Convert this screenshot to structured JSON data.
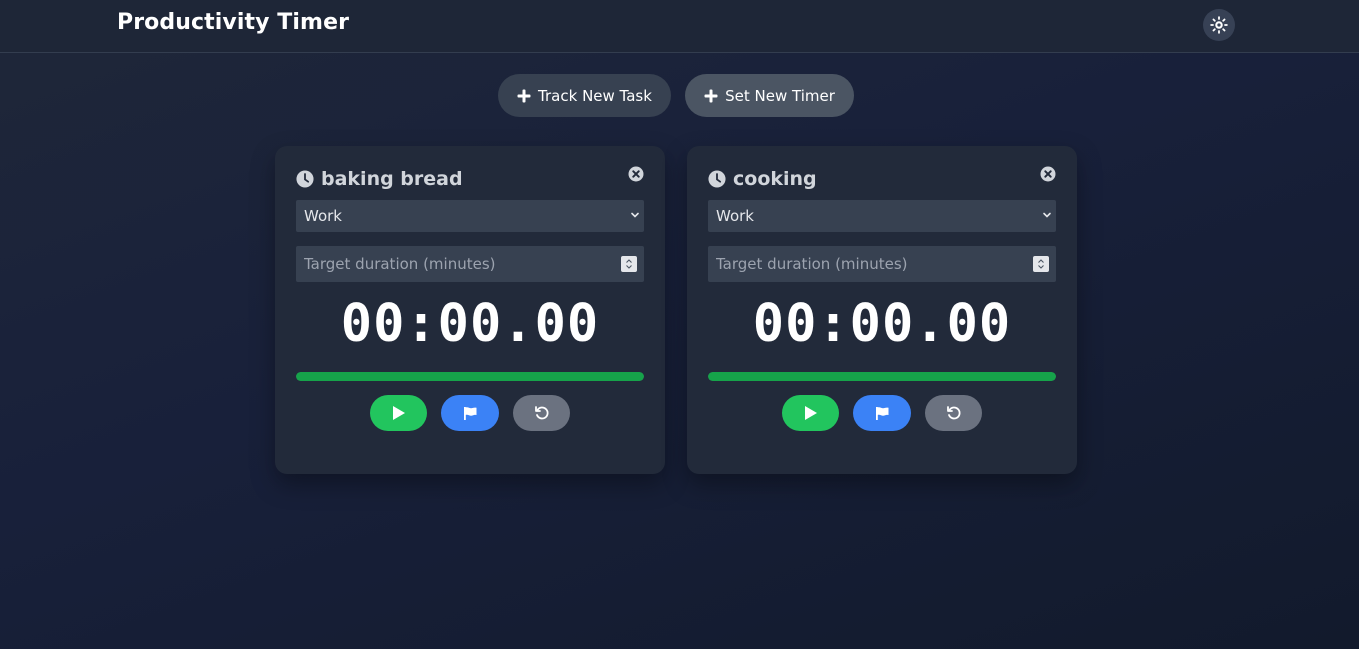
{
  "header": {
    "title": "Productivity Timer",
    "theme_icon": "sun-icon"
  },
  "actions": {
    "track_label": "Track New Task",
    "timer_label": "Set New Timer"
  },
  "cards": [
    {
      "title": "baking bread",
      "category": "Work",
      "duration_placeholder": "Target duration (minutes)",
      "time": "00:00.00",
      "progress": 1.0
    },
    {
      "title": "cooking",
      "category": "Work",
      "duration_placeholder": "Target duration (minutes)",
      "time": "00:00.00",
      "progress": 1.0
    }
  ],
  "colors": {
    "play": "#22c55e",
    "lap": "#3b82f6",
    "reset": "#6b7280",
    "progress": "#16a34a"
  }
}
